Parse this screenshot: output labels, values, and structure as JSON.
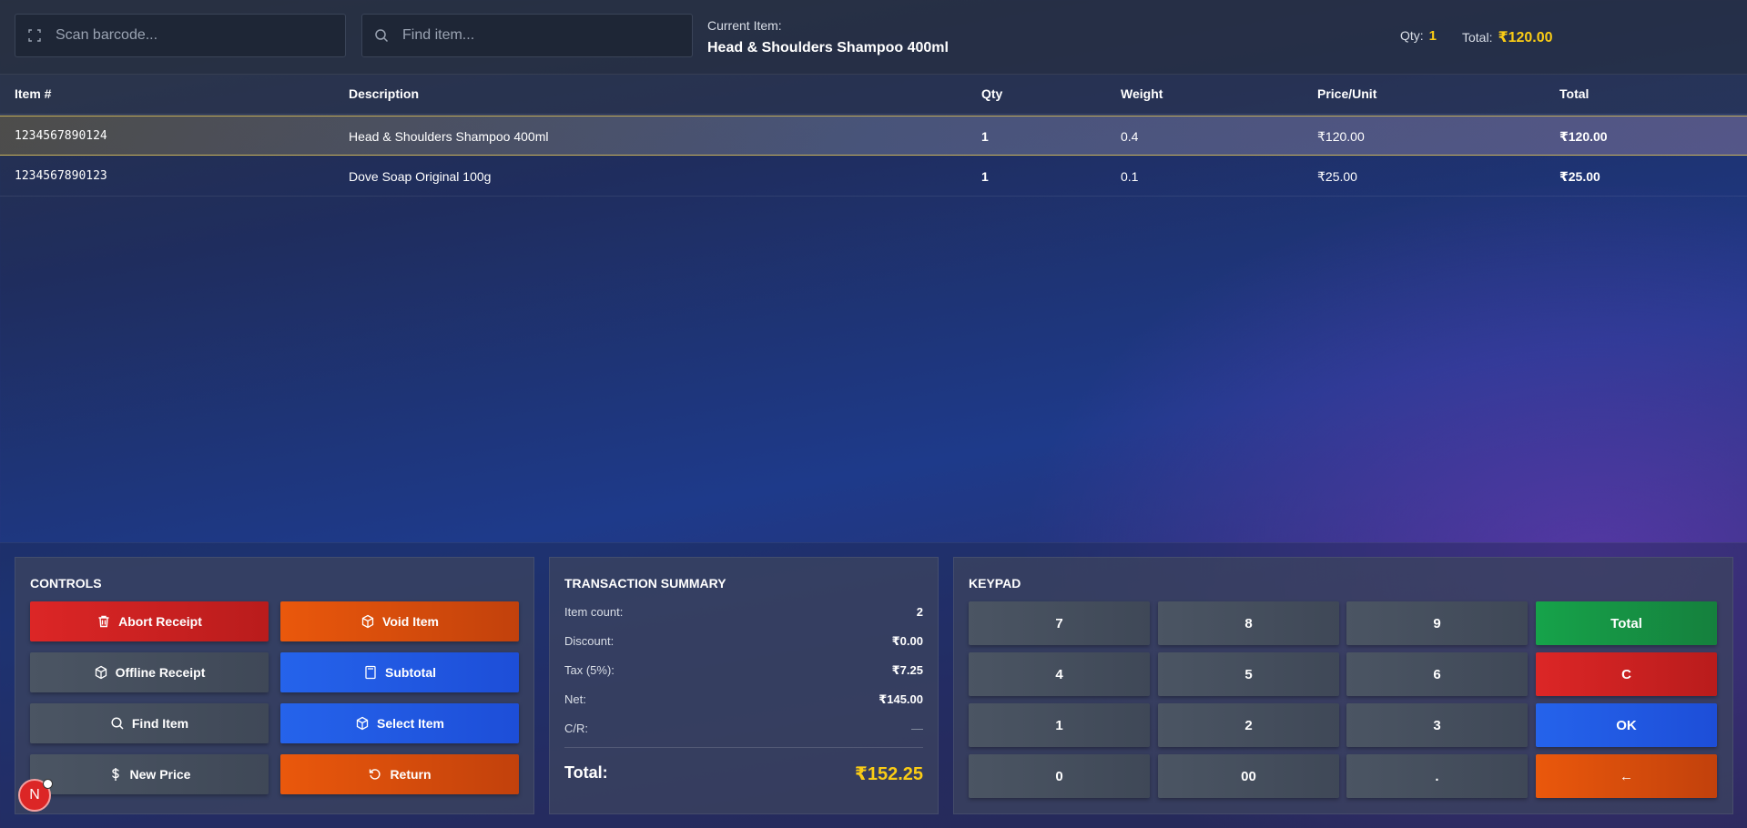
{
  "topbar": {
    "scan_placeholder": "Scan barcode...",
    "find_placeholder": "Find item...",
    "current_item_label": "Current Item:",
    "current_item_name": "Head & Shoulders Shampoo 400ml",
    "qty_label": "Qty:",
    "qty_value": "1",
    "total_label": "Total:",
    "total_value": "₹120.00"
  },
  "table": {
    "headers": [
      "Item #",
      "Description",
      "Qty",
      "Weight",
      "Price/Unit",
      "Total"
    ],
    "rows": [
      {
        "item": "1234567890124",
        "description": "Head & Shoulders Shampoo 400ml",
        "qty": "1",
        "weight": "0.4",
        "price": "₹120.00",
        "total": "₹120.00",
        "selected": true
      },
      {
        "item": "1234567890123",
        "description": "Dove Soap Original 100g",
        "qty": "1",
        "weight": "0.1",
        "price": "₹25.00",
        "total": "₹25.00",
        "selected": false
      }
    ]
  },
  "controls": {
    "title": "CONTROLS",
    "buttons": [
      {
        "label": "Abort Receipt",
        "icon": "trash-icon",
        "color": "#dc2626"
      },
      {
        "label": "Void Item",
        "icon": "box-icon",
        "color": "#ea580c"
      },
      {
        "label": "Offline Receipt",
        "icon": "box-icon",
        "color": "#4b5563"
      },
      {
        "label": "Subtotal",
        "icon": "calculator-icon",
        "color": "#2563eb"
      },
      {
        "label": "Find Item",
        "icon": "search-icon",
        "color": "#4b5563"
      },
      {
        "label": "Select Item",
        "icon": "box-icon",
        "color": "#2563eb"
      },
      {
        "label": "New Price",
        "icon": "dollar-icon",
        "color": "#4b5563"
      },
      {
        "label": "Return",
        "icon": "rotate-ccw-icon",
        "color": "#ea580c"
      }
    ]
  },
  "summary": {
    "title": "TRANSACTION SUMMARY",
    "rows": [
      {
        "label": "Item count:",
        "value": "2"
      },
      {
        "label": "Discount:",
        "value": "₹0.00"
      },
      {
        "label": "Tax (5%):",
        "value": "₹7.25"
      },
      {
        "label": "Net:",
        "value": "₹145.00"
      },
      {
        "label": "C/R:",
        "value": "—"
      }
    ],
    "total_label": "Total:",
    "total_value": "₹152.25"
  },
  "keypad": {
    "title": "KEYPAD",
    "keys": [
      "7",
      "8",
      "9",
      "Total",
      "4",
      "5",
      "6",
      "C",
      "1",
      "2",
      "3",
      "OK",
      "0",
      "00",
      ".",
      "←"
    ]
  },
  "avatar": {
    "initial": "N"
  },
  "colors": {
    "accent_yellow": "#facc15",
    "danger": "#dc2626",
    "warning": "#ea580c",
    "primary": "#2563eb",
    "success": "#16a34a"
  }
}
